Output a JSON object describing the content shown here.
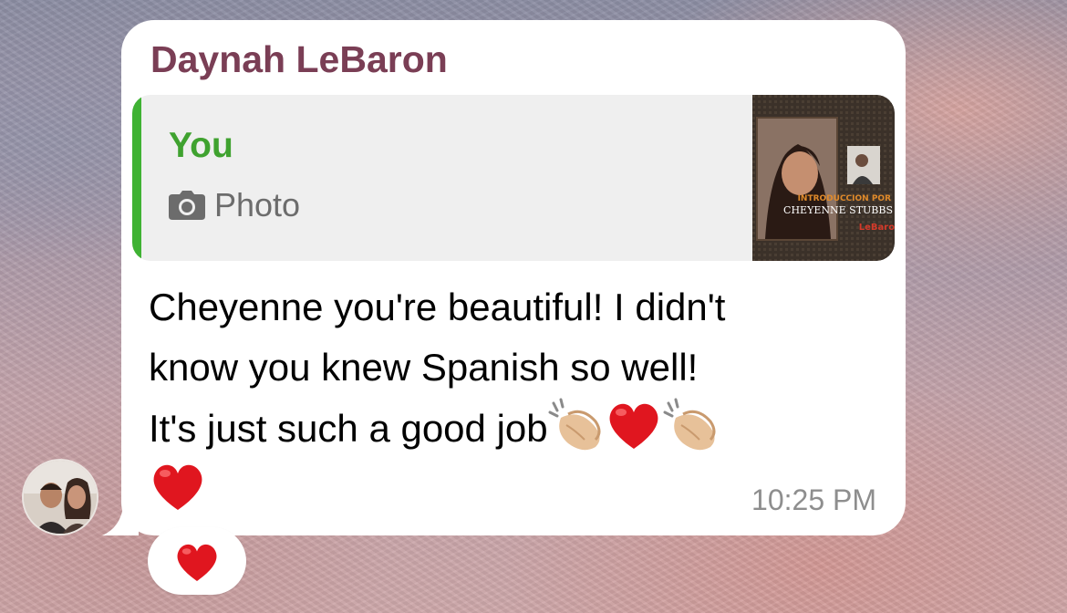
{
  "message": {
    "sender_name": "Daynah LeBaron",
    "reply": {
      "author": "You",
      "type_label": "Photo",
      "thumbnail_caption": "INTRODUCCION POR",
      "thumbnail_name": "CHEYENNE STUBBS",
      "thumbnail_logo": "LeBaron"
    },
    "text_lines": [
      "Cheyenne you're beautiful! I didn't",
      "know you knew Spanish so well!",
      "It's just such a good job"
    ],
    "time": "10:25 PM",
    "reaction_emoji": "heart"
  },
  "colors": {
    "sender_name": "#7a3e55",
    "reply_bar": "#3fb233",
    "reply_author": "#3fa22f",
    "bubble": "#ffffff"
  },
  "icons": [
    "camera-icon",
    "clapping-hands-emoji",
    "red-heart-emoji"
  ]
}
